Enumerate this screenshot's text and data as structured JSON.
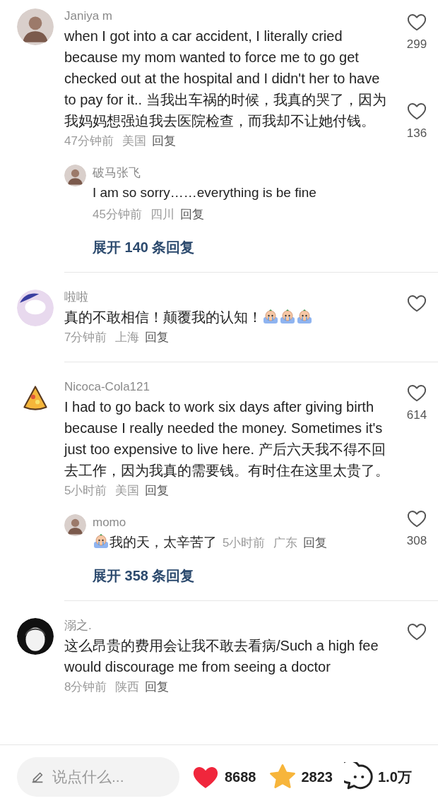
{
  "comments": [
    {
      "author": "Janiya m",
      "avatar": {
        "kind": "photo"
      },
      "likes": "299",
      "liked": false,
      "content": [
        {
          "kind": "text",
          "text": "when I got into a car accident, I literally cried because my mom wanted to force me to go get checked out at the hospital and I didn't her to have to pay for it.. 当我出车祸的时候，我真的哭了，因为我妈妈想强迫我去医院检查，而我却不让她付钱。"
        }
      ],
      "time": "47分钟前",
      "location": "美国",
      "reply": "回复",
      "replies": [
        {
          "author": "破马张飞",
          "avatar": {
            "kind": "photo"
          },
          "likes": "136",
          "liked": false,
          "content": [
            {
              "kind": "text",
              "text": "I am so sorry……everything is be fine"
            }
          ],
          "meta_inline": false,
          "time": "45分钟前",
          "location": "四川",
          "reply": "回复"
        }
      ],
      "expand": "展开 140 条回复"
    },
    {
      "author": "啦啦",
      "avatar": {
        "kind": "blur"
      },
      "liked": false,
      "content": [
        {
          "kind": "text",
          "text": "真的不敢相信！颠覆我的认知！"
        },
        {
          "kind": "emoji"
        },
        {
          "kind": "emoji"
        },
        {
          "kind": "emoji"
        }
      ],
      "time": "7分钟前",
      "location": "上海",
      "reply": "回复"
    },
    {
      "author": "Nicoca-Cola121",
      "avatar": {
        "kind": "pizza"
      },
      "likes": "614",
      "liked": false,
      "content": [
        {
          "kind": "text",
          "text": "I had to go back to work six days after giving birth because I really needed the money. Sometimes it's just too expensive to live here. 产后六天我不得不回去工作，因为我真的需要钱。有时住在这里太贵了。"
        }
      ],
      "time": "5小时前",
      "location": "美国",
      "reply": "回复",
      "replies": [
        {
          "author": "momo",
          "avatar": {
            "kind": "photo"
          },
          "likes": "308",
          "liked": false,
          "content": [
            {
              "kind": "emoji"
            },
            {
              "kind": "text",
              "text": "我的天，太辛苦了"
            }
          ],
          "meta_inline": true,
          "time": "5小时前",
          "location": "广东",
          "reply": "回复"
        }
      ],
      "expand": "展开 358 条回复"
    },
    {
      "author": "溺之.",
      "avatar": {
        "kind": "sketch"
      },
      "liked": false,
      "content": [
        {
          "kind": "text",
          "text": "这么昂贵的费用会让我不敢去看病/Such a high fee would discourage me from seeing a doctor"
        }
      ],
      "time": "8分钟前",
      "location": "陕西",
      "reply": "回复"
    }
  ],
  "bottom_bar": {
    "input": {
      "placeholder": "说点什么..."
    },
    "likes": {
      "count": "8688",
      "liked": true
    },
    "favorites": {
      "count": "2823",
      "favorited": true
    },
    "comments": {
      "count": "1.0万"
    }
  }
}
